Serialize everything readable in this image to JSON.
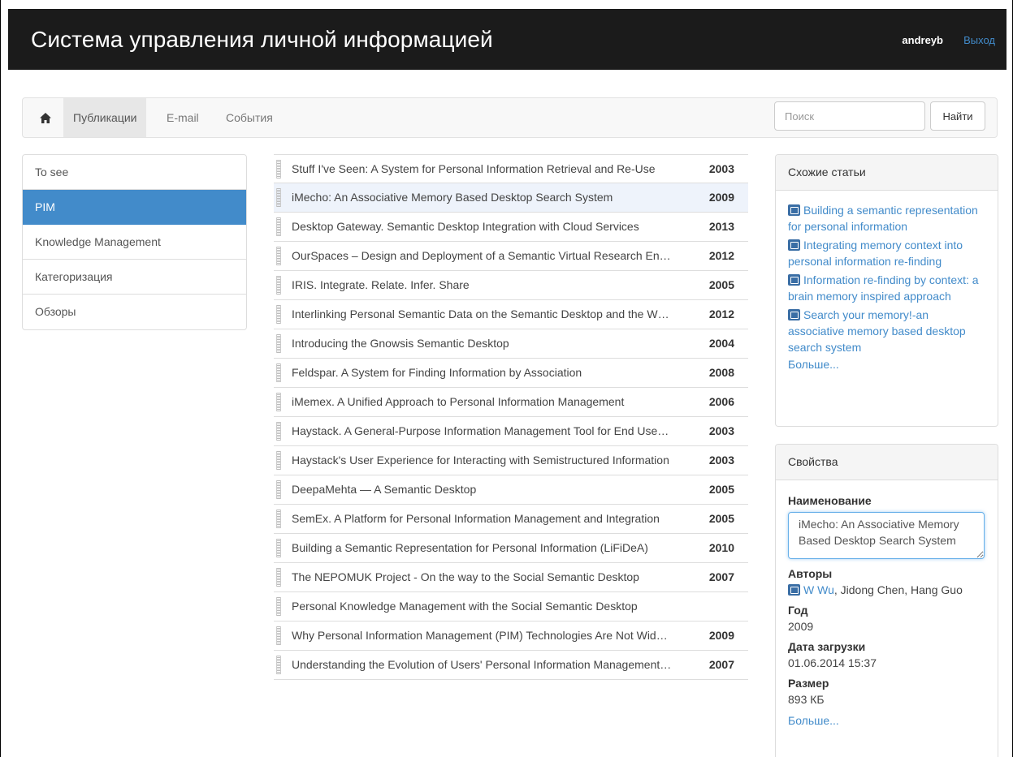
{
  "header": {
    "title": "Система управления личной информацией",
    "user": "andreyb",
    "logout": "Выход"
  },
  "nav": {
    "items": [
      {
        "label": "Публикации"
      },
      {
        "label": "E-mail"
      },
      {
        "label": "События"
      }
    ],
    "search_placeholder": "Поиск",
    "search_button": "Найти"
  },
  "categories": [
    "To see",
    "PIM",
    "Knowledge Management",
    "Категоризация",
    "Обзоры"
  ],
  "publications": [
    {
      "title": "Stuff I've Seen: A System for Personal Information Retrieval and Re-Use",
      "year": "2003"
    },
    {
      "title": "iMecho: An Associative Memory Based Desktop Search System",
      "year": "2009"
    },
    {
      "title": "Desktop Gateway. Semantic Desktop Integration with Cloud Services",
      "year": "2013"
    },
    {
      "title": "OurSpaces – Design and Deployment of a Semantic Virtual Research En…",
      "year": "2012"
    },
    {
      "title": "IRIS. Integrate. Relate. Infer. Share",
      "year": "2005"
    },
    {
      "title": "Interlinking Personal Semantic Data on the Semantic Desktop and the W…",
      "year": "2012"
    },
    {
      "title": "Introducing the Gnowsis Semantic Desktop",
      "year": "2004"
    },
    {
      "title": "Feldspar. A System for Finding Information by Association",
      "year": "2008"
    },
    {
      "title": "iMemex. A Unified Approach to Personal Information Management",
      "year": "2006"
    },
    {
      "title": "Haystack. A General-Purpose Information Management Tool for End Use…",
      "year": "2003"
    },
    {
      "title": "Haystack's User Experience for Interacting with Semistructured Information",
      "year": "2003"
    },
    {
      "title": "DeepaMehta — A Semantic Desktop",
      "year": "2005"
    },
    {
      "title": "SemEx. A Platform for Personal Information Management and Integration",
      "year": "2005"
    },
    {
      "title": "Building a Semantic Representation for Personal Information (LiFiDeA)",
      "year": "2010"
    },
    {
      "title": "The NEPOMUK Project - On the way to the Social Semantic Desktop",
      "year": "2007"
    },
    {
      "title": "Personal Knowledge Management with the Social Semantic Desktop",
      "year": ""
    },
    {
      "title": "Why Personal Information Management (PIM) Technologies Are Not Wid…",
      "year": "2009"
    },
    {
      "title": "Understanding the Evolution of Users' Personal Information Management…",
      "year": "2007"
    }
  ],
  "similar": {
    "title": "Схожие статьи",
    "items": [
      "Building a semantic representation for personal information",
      "Integrating memory context into personal information re-finding",
      "Information re-finding by context: a brain memory inspired approach",
      "Search your memory!-an associative memory based desktop search system"
    ],
    "more": "Больше..."
  },
  "properties": {
    "title": "Свойства",
    "name_label": "Наименование",
    "name_value": "iMecho: An Associative Memory Based Desktop Search System",
    "authors_label": "Авторы",
    "authors_link": "W Wu",
    "authors_rest": ", Jidong Chen, Hang Guo",
    "year_label": "Год",
    "year_value": "2009",
    "upload_label": "Дата загрузки",
    "upload_value": "01.06.2014 15:37",
    "size_label": "Размер",
    "size_value": "893 КБ",
    "more": "Больше..."
  },
  "colors": {
    "header_bg": "#1b1b1b",
    "accent": "#428bca",
    "selected_row": "#eef3fb"
  }
}
